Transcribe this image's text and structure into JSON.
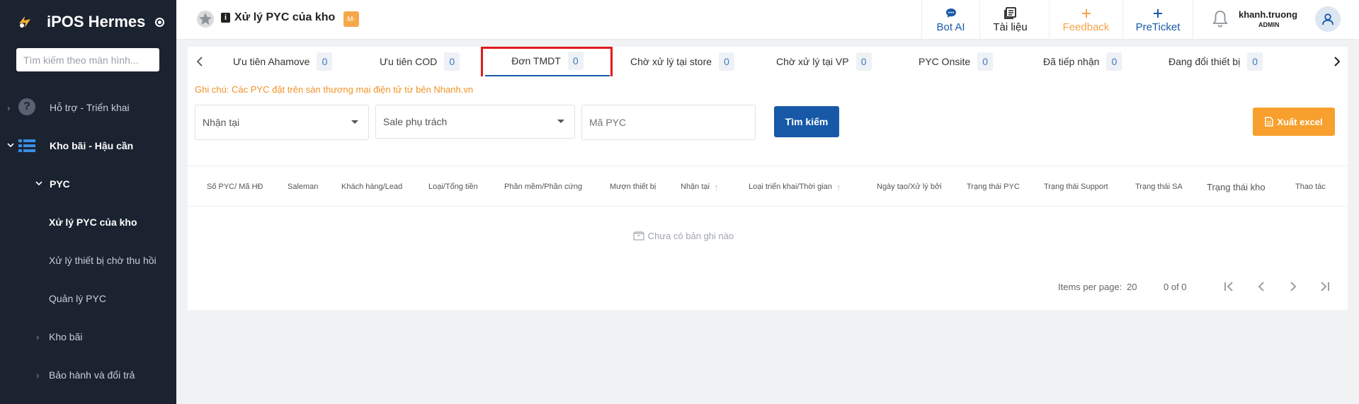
{
  "sidebar": {
    "brand": "iPOS Hermes",
    "search_placeholder": "Tìm kiếm theo màn hình...",
    "items": [
      {
        "label": "Hỗ trợ - Triển khai"
      },
      {
        "label": "Kho bãi - Hậu cần"
      },
      {
        "label": "PYC"
      },
      {
        "label": "Xử lý PYC của kho"
      },
      {
        "label": "Xử lý thiết bị chờ thu hồi"
      },
      {
        "label": "Quản lý PYC"
      },
      {
        "label": "Kho bãi"
      },
      {
        "label": "Bảo hành và đổi trả"
      }
    ]
  },
  "header": {
    "title": "Xử lý PYC của kho",
    "info_badge": "i",
    "badge": "M-",
    "buttons": [
      {
        "label": "Bot AI",
        "icon": "chat-bubble-icon",
        "color": "#1a5aa8"
      },
      {
        "label": "Tài liệu",
        "icon": "document-icon",
        "color": "#222222"
      },
      {
        "label": "Feedback",
        "icon": "plus-icon",
        "color": "#f5a34a"
      },
      {
        "label": "PreTicket",
        "icon": "plus-icon",
        "color": "#1a5aa8"
      }
    ],
    "user": {
      "name": "khanh.truong",
      "role": "ADMIN"
    }
  },
  "tabs": [
    {
      "label": "Ưu tiên Ahamove",
      "count": "0"
    },
    {
      "label": "Ưu tiên COD",
      "count": "0"
    },
    {
      "label": "Đơn TMDT",
      "count": "0"
    },
    {
      "label": "Chờ xử lý tại store",
      "count": "0"
    },
    {
      "label": "Chờ xử lý tại VP",
      "count": "0"
    },
    {
      "label": "PYC Onsite",
      "count": "0"
    },
    {
      "label": "Đã tiếp nhận",
      "count": "0"
    },
    {
      "label": "Đang đổi thiết bị",
      "count": "0"
    }
  ],
  "active_tab": "Đơn TMDT",
  "note": "Ghi chú: Các PYC đặt trên sàn thương mại điện tử từ bên Nhanh.vn",
  "filters": {
    "received_at": "Nhận tại",
    "sale": "Sale phụ trách",
    "code_placeholder": "Mã PYC",
    "search_button": "Tìm kiếm",
    "export_button": "Xuất excel"
  },
  "table": {
    "columns": [
      "Số PYC/ Mã HĐ",
      "Saleman",
      "Khách hàng/Lead",
      "Loại/Tổng tiền",
      "Phần mềm/Phần cứng",
      "Mượn thiết bị",
      "Nhận tại",
      "Loại triển khai/Thời gian",
      "Ngày tạo/Xử lý bởi",
      "Trạng thái PYC",
      "Trạng thái Support",
      "Trạng thái SA",
      "Trạng thái kho",
      "Thao tác"
    ],
    "empty_text": "Chưa có bản ghi nào"
  },
  "pagination": {
    "label": "Items per page:",
    "size": "20",
    "range": "0 of 0"
  },
  "colors": {
    "sidebar_bg": "#1b2331",
    "primary": "#1759a7",
    "accent_orange": "#f7a02d",
    "highlight": "#e01b1b"
  }
}
